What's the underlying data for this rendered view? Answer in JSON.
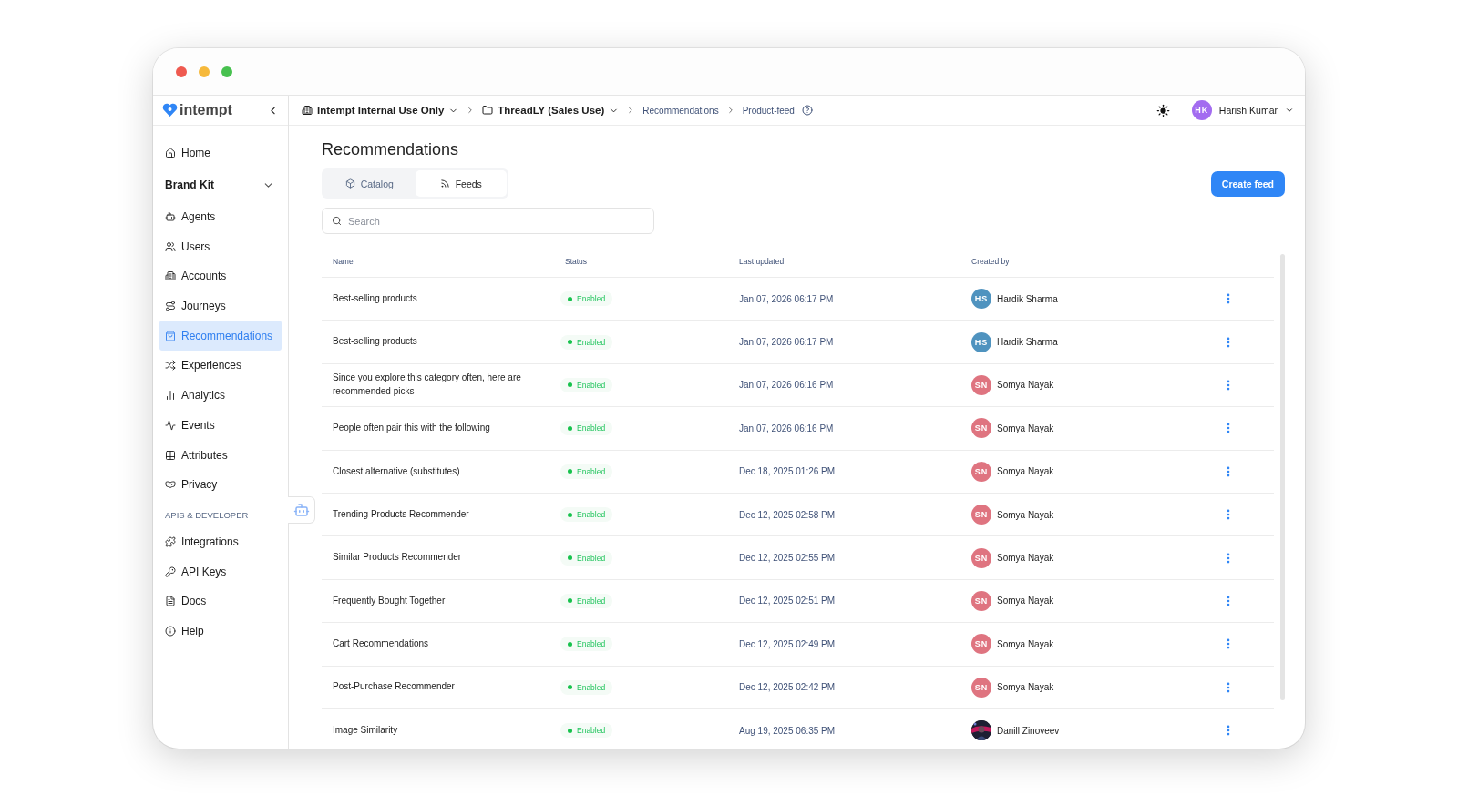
{
  "brand": {
    "name": "intempt"
  },
  "breadcrumbs": [
    {
      "label": "Intempt Internal Use Only",
      "kind": "dropdown"
    },
    {
      "label": "ThreadLY (Sales Use)",
      "kind": "dropdown"
    },
    {
      "label": "Recommendations",
      "kind": "link"
    },
    {
      "label": "Product-feed",
      "kind": "link"
    }
  ],
  "user": {
    "initials": "HK",
    "name": "Harish Kumar"
  },
  "sidebar": {
    "items": [
      {
        "kind": "item",
        "label": "Home",
        "selected": false
      },
      {
        "kind": "group",
        "label": "Brand Kit",
        "expanded": false
      },
      {
        "kind": "item",
        "label": "Agents",
        "selected": false
      },
      {
        "kind": "item",
        "label": "Users",
        "selected": false
      },
      {
        "kind": "item",
        "label": "Accounts",
        "selected": false
      },
      {
        "kind": "item",
        "label": "Journeys",
        "selected": false
      },
      {
        "kind": "item",
        "label": "Recommendations",
        "selected": true
      },
      {
        "kind": "item",
        "label": "Experiences",
        "selected": false
      },
      {
        "kind": "item",
        "label": "Analytics",
        "selected": false
      },
      {
        "kind": "item",
        "label": "Events",
        "selected": false
      },
      {
        "kind": "item",
        "label": "Attributes",
        "selected": false
      },
      {
        "kind": "item",
        "label": "Privacy",
        "selected": false
      },
      {
        "kind": "section",
        "label": "APIS & DEVELOPER"
      },
      {
        "kind": "item",
        "label": "Integrations",
        "selected": false
      },
      {
        "kind": "item",
        "label": "API Keys",
        "selected": false
      },
      {
        "kind": "item",
        "label": "Docs",
        "selected": false
      },
      {
        "kind": "item",
        "label": "Help",
        "selected": false
      }
    ]
  },
  "page": {
    "title": "Recommendations",
    "create_button": "Create feed"
  },
  "tabs": [
    {
      "label": "Catalog",
      "selected": false
    },
    {
      "label": "Feeds",
      "selected": true
    }
  ],
  "search": {
    "placeholder": "Search"
  },
  "table": {
    "columns": [
      "Name",
      "Status",
      "Last updated",
      "Created by"
    ],
    "rows": [
      {
        "name": "Best-selling products",
        "status": "Enabled",
        "updated": "Jan 07, 2026 06:17 PM",
        "creator": {
          "name": "Hardik Sharma",
          "kind": "initials",
          "initials": "HS",
          "color": "#4f93bf"
        }
      },
      {
        "name": "Best-selling products",
        "status": "Enabled",
        "updated": "Jan 07, 2026 06:17 PM",
        "creator": {
          "name": "Hardik Sharma",
          "kind": "initials",
          "initials": "HS",
          "color": "#4f93bf"
        }
      },
      {
        "name": "Since you explore this category often, here are recommended picks",
        "status": "Enabled",
        "updated": "Jan 07, 2026 06:16 PM",
        "creator": {
          "name": "Somya Nayak",
          "kind": "initials",
          "initials": "SN",
          "color": "#df7480"
        }
      },
      {
        "name": "People often pair this with the following",
        "status": "Enabled",
        "updated": "Jan 07, 2026 06:16 PM",
        "creator": {
          "name": "Somya Nayak",
          "kind": "initials",
          "initials": "SN",
          "color": "#df7480"
        }
      },
      {
        "name": "Closest alternative (substitutes)",
        "status": "Enabled",
        "updated": "Dec 18, 2025 01:26 PM",
        "creator": {
          "name": "Somya Nayak",
          "kind": "initials",
          "initials": "SN",
          "color": "#df7480"
        }
      },
      {
        "name": "Trending Products Recommender",
        "status": "Enabled",
        "updated": "Dec 12, 2025 02:58 PM",
        "creator": {
          "name": "Somya Nayak",
          "kind": "initials",
          "initials": "SN",
          "color": "#df7480"
        }
      },
      {
        "name": "Similar Products Recommender",
        "status": "Enabled",
        "updated": "Dec 12, 2025 02:55 PM",
        "creator": {
          "name": "Somya Nayak",
          "kind": "initials",
          "initials": "SN",
          "color": "#df7480"
        }
      },
      {
        "name": "Frequently Bought Together",
        "status": "Enabled",
        "updated": "Dec 12, 2025 02:51 PM",
        "creator": {
          "name": "Somya Nayak",
          "kind": "initials",
          "initials": "SN",
          "color": "#df7480"
        }
      },
      {
        "name": "Cart Recommendations",
        "status": "Enabled",
        "updated": "Dec 12, 2025 02:49 PM",
        "creator": {
          "name": "Somya Nayak",
          "kind": "initials",
          "initials": "SN",
          "color": "#df7480"
        }
      },
      {
        "name": "Post-Purchase Recommender",
        "status": "Enabled",
        "updated": "Dec 12, 2025 02:42 PM",
        "creator": {
          "name": "Somya Nayak",
          "kind": "initials",
          "initials": "SN",
          "color": "#df7480"
        }
      },
      {
        "name": "Image Similarity",
        "status": "Enabled",
        "updated": "Aug 19, 2025 06:35 PM",
        "creator": {
          "name": "Danill Zinoveev",
          "kind": "picture"
        }
      }
    ]
  }
}
